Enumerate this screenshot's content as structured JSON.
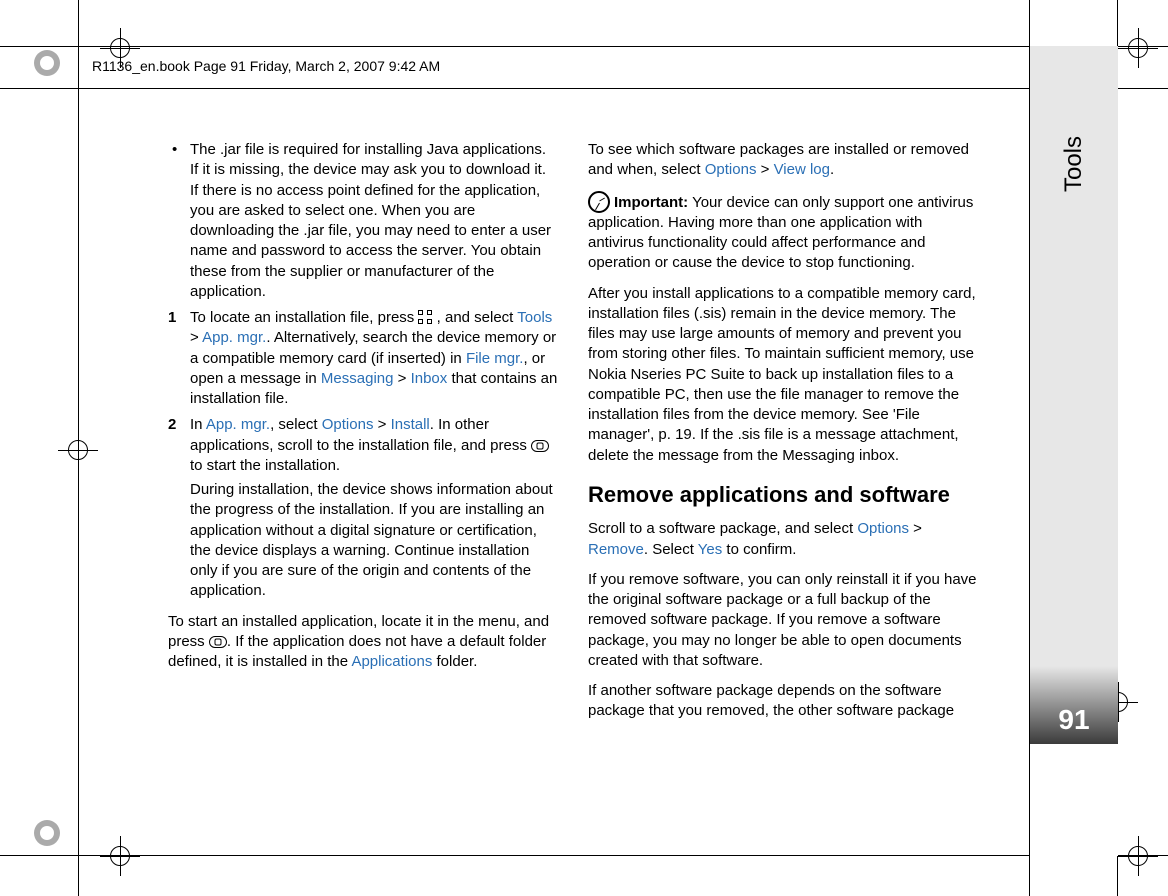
{
  "header": "R1136_en.book  Page 91  Friday, March 2, 2007  9:42 AM",
  "sidebar": {
    "label": "Tools",
    "page": "91"
  },
  "left": {
    "bullet1": "The .jar file is required for installing Java applications. If it is missing, the device may ask you to download it. If there is no access point defined for the application, you are asked to select one. When you are downloading the .jar file, you may need to enter a user name and password to access the server. You obtain these from the supplier or manufacturer of the application.",
    "step1_a": "To locate an installation file, press ",
    "step1_b": " , and select ",
    "step1_tools": "Tools",
    "step1_gt1": " > ",
    "step1_appmgr": "App. mgr.",
    "step1_c": ". Alternatively, search the device memory or a compatible memory card (if inserted) in ",
    "step1_filemgr": "File mgr.",
    "step1_d": ", or open a message in ",
    "step1_messaging": "Messaging",
    "step1_gt2": " > ",
    "step1_inbox": "Inbox",
    "step1_e": " that contains an installation file.",
    "step2_a": "In ",
    "step2_appmgr": "App. mgr.",
    "step2_b": ", select ",
    "step2_options": "Options",
    "step2_gt": " > ",
    "step2_install": "Install",
    "step2_c": ". In other applications, scroll to the installation file, and press ",
    "step2_d": " to start the installation.",
    "step2_note": "During installation, the device shows information about the progress of the installation. If you are installing an application without a digital signature or certification, the device displays a warning. Continue installation only if you are sure of the origin and contents of the application.",
    "p_start_a": "To start an installed application, locate it in the menu, and press ",
    "p_start_b": ". If the application does not have a default folder defined, it is installed in the ",
    "p_start_apps": "Applications",
    "p_start_c": " folder.",
    "p_log_a": "To see which software packages are installed or removed and when, select ",
    "p_log_options": "Options",
    "p_log_gt": " > ",
    "p_log_viewlog": "View log",
    "p_log_b": "."
  },
  "right": {
    "important_label": "Important:",
    "important_text": " Your device can only support one antivirus application. Having more than one application with antivirus functionality could affect performance and operation or cause the device to stop functioning.",
    "p_after": "After you install applications to a compatible memory card, installation files (.sis) remain in the device memory. The files may use large amounts of memory and prevent you from storing other files. To maintain sufficient memory, use Nokia Nseries PC Suite to back up installation files to a compatible PC, then use the file manager to remove the installation files from the device memory. See 'File manager', p. 19. If the .sis file is a message attachment, delete the message from the Messaging inbox.",
    "heading": "Remove applications and software",
    "p_remove_a": "Scroll to a software package, and select ",
    "p_remove_options": "Options",
    "p_remove_gt": " > ",
    "p_remove_remove": "Remove",
    "p_remove_b": ". Select ",
    "p_remove_yes": "Yes",
    "p_remove_c": " to confirm.",
    "p_reinstall": "If you remove software, you can only reinstall it if you have the original software package or a full backup of the removed software package. If you remove a software package, you may no longer be able to open documents created with that software.",
    "p_depends": "If another software package depends on the software package that you removed, the other software package"
  }
}
